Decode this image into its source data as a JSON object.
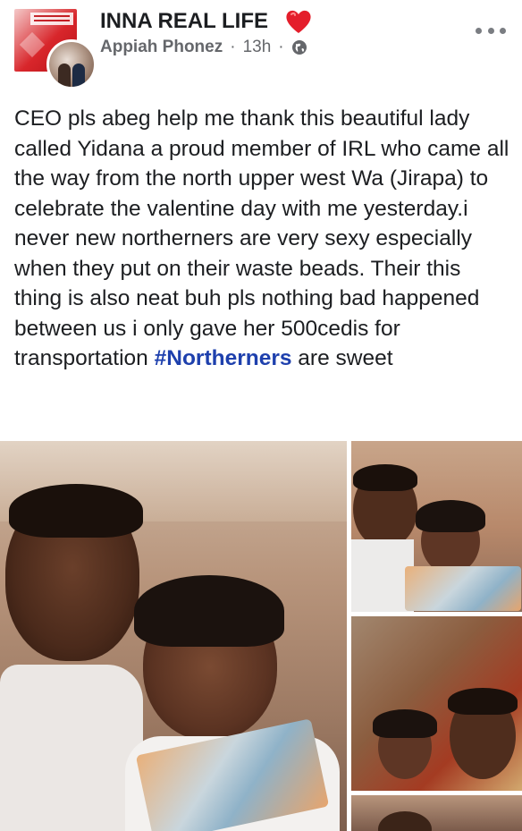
{
  "header": {
    "group_name": "INNA REAL LIFE",
    "author": "Appiah Phonez",
    "separator": "·",
    "time": "13h",
    "privacy_icon": "globe-icon",
    "heart_icon": "red-heart-icon",
    "more_icon": "more-options-icon"
  },
  "post": {
    "text_before_hashtag": "CEO pls abeg help me thank this beautiful lady called Yidana a proud member of IRL who came all the way from the north upper west Wa (Jirapa) to celebrate the valentine day with me yesterday.i never new northerners are very sexy especially when they put on their waste beads. Their this thing is also neat buh pls nothing bad happened between us i only gave her 500cedis for transportation ",
    "hashtag": "#Northerners",
    "text_after_hashtag": " are sweet"
  },
  "colors": {
    "hashtag": "#1e40ad",
    "heart": "#e41e2b",
    "meta": "#65676b",
    "text": "#1c1e21"
  },
  "photos": [
    {
      "name": "photo-main",
      "label": "selfie"
    },
    {
      "name": "photo-top-right",
      "label": "selfie"
    },
    {
      "name": "photo-middle-right",
      "label": "selfie"
    },
    {
      "name": "photo-bottom-right",
      "label": "photo"
    }
  ]
}
